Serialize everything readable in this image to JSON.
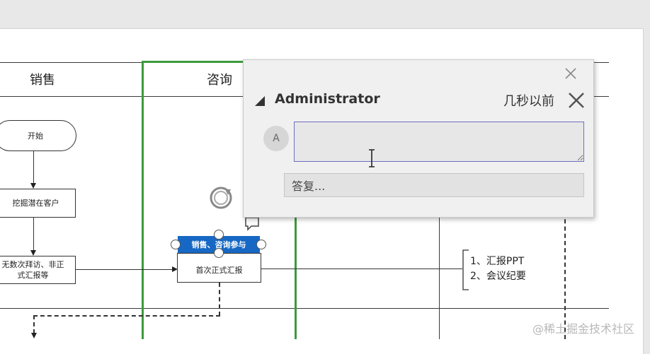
{
  "lanes": {
    "sales": "销售",
    "consult": "咨询"
  },
  "flowchart": {
    "start": "开始",
    "find_customer": "挖掘潜在客户",
    "visits": "无数次拜访、非正式汇报等",
    "first_report": "首次正式汇报",
    "selected_label": "销售、咨询参与"
  },
  "annotation": {
    "line1": "1、汇报PPT",
    "line2": "2、会议纪要"
  },
  "comment": {
    "author": "Administrator",
    "time": "几秒以前",
    "avatar_letter": "A",
    "input_value": "",
    "reply_placeholder": "答复..."
  },
  "watermark": "@稀土掘金技术社区",
  "colors": {
    "selection": "#1768c4",
    "lane_highlight": "#3c9a3c",
    "input_border": "#6b6fbf"
  }
}
